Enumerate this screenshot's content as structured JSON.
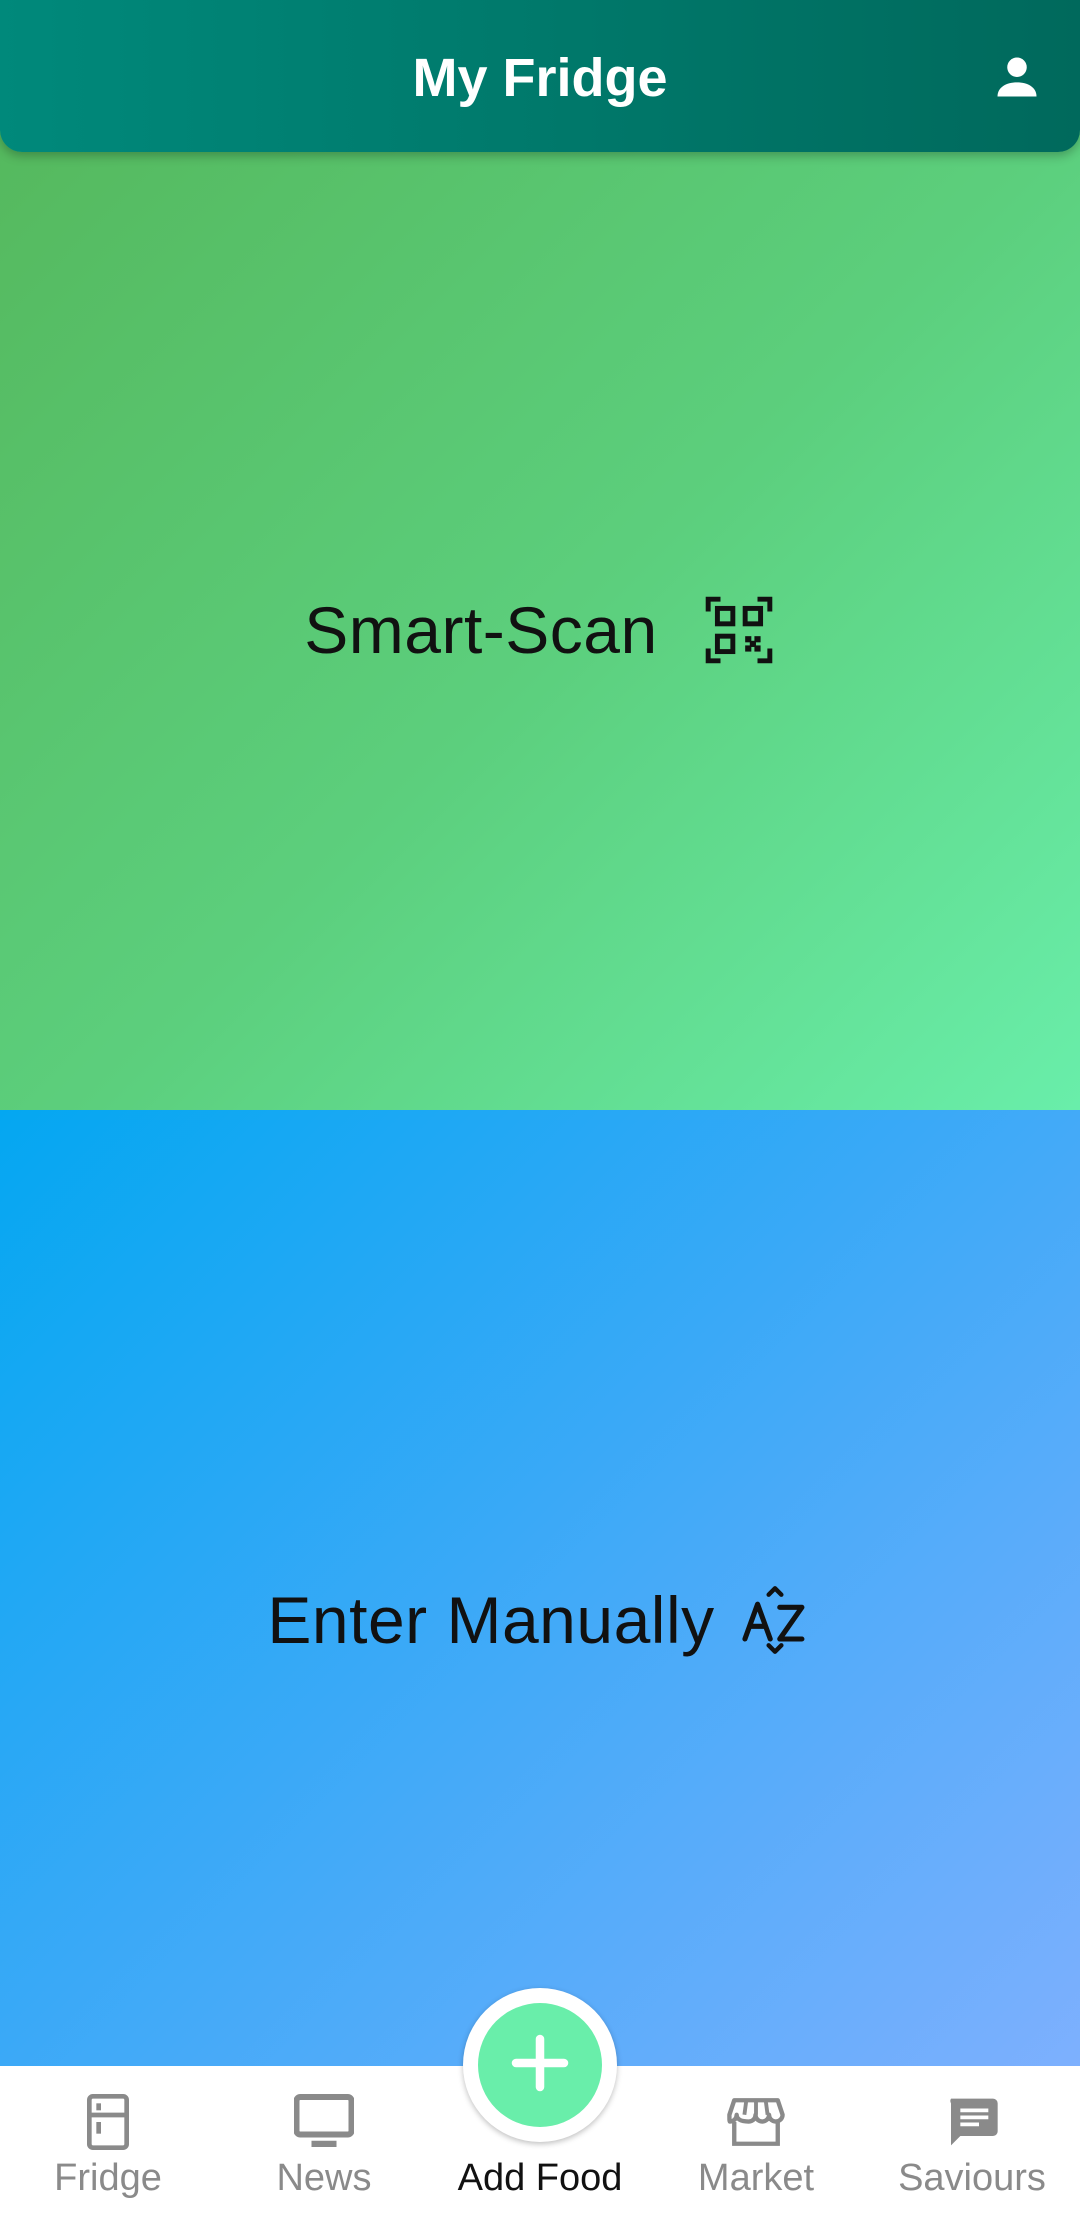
{
  "header": {
    "title": "My Fridge",
    "profile_icon": "person-icon"
  },
  "panels": {
    "smart_scan": {
      "label": "Smart-Scan",
      "icon": "qr-code-icon"
    },
    "manual": {
      "label": "Enter Manually",
      "icon": "sort-az-icon"
    }
  },
  "bottom_nav": {
    "items": [
      {
        "label": "Fridge",
        "icon": "fridge-icon",
        "active": false
      },
      {
        "label": "News",
        "icon": "monitor-icon",
        "active": false
      },
      {
        "label": "Add Food",
        "icon": "add-icon",
        "active": true
      },
      {
        "label": "Market",
        "icon": "storefront-icon",
        "active": false
      },
      {
        "label": "Saviours",
        "icon": "chat-icon",
        "active": false
      }
    ]
  },
  "colors": {
    "header": "#00796b",
    "scan_start": "#54b65a",
    "scan_end": "#69eeaa",
    "manual_start": "#04a7f1",
    "manual_end": "#80b0fe",
    "fab": "#69eeaa",
    "nav_inactive": "#8a8a8a",
    "nav_active": "#111111"
  }
}
